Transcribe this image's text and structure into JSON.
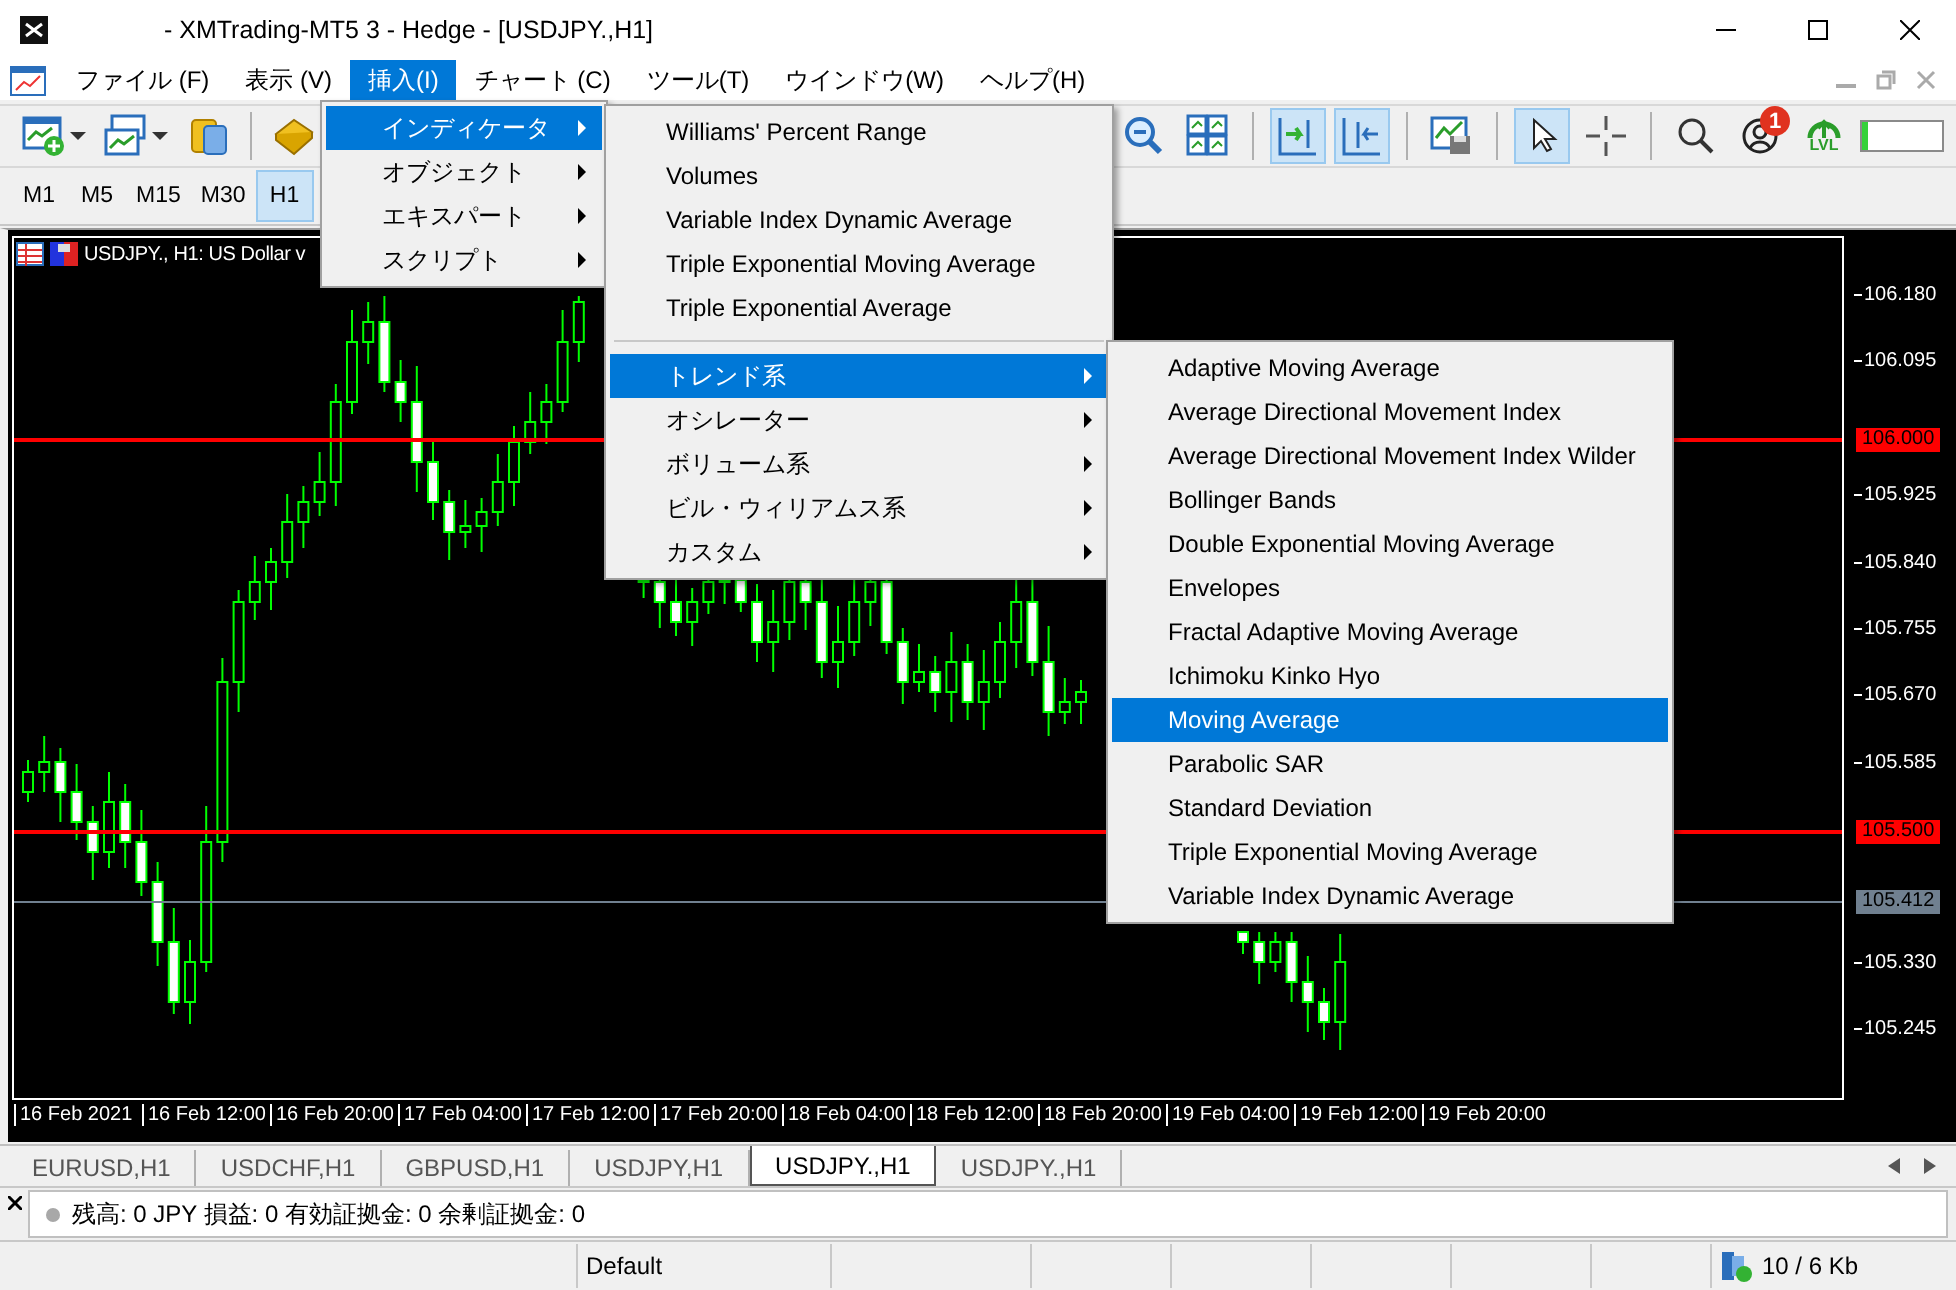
{
  "window": {
    "title": "- XMTrading-MT5 3 - Hedge - [USDJPY.,H1]"
  },
  "menu_bar": [
    {
      "label": "ファイル (F)",
      "selected": false
    },
    {
      "label": "表示 (V)",
      "selected": false
    },
    {
      "label": "挿入(I)",
      "selected": true
    },
    {
      "label": "チャート (C)",
      "selected": false
    },
    {
      "label": "ツール(T)",
      "selected": false
    },
    {
      "label": "ウインドウ(W)",
      "selected": false
    },
    {
      "label": "ヘルプ(H)",
      "selected": false
    }
  ],
  "toolbar_left": [
    {
      "kind": "new-chart",
      "dropdown": true,
      "pressed": false
    },
    {
      "kind": "profiles",
      "dropdown": true,
      "pressed": false
    },
    {
      "kind": "coins",
      "dropdown": false,
      "pressed": false
    },
    {
      "kind": "separator"
    },
    {
      "kind": "book",
      "dropdown": false,
      "pressed": false
    }
  ],
  "toolbar_right": [
    {
      "kind": "zoom-out",
      "pressed": false
    },
    {
      "kind": "tile",
      "pressed": false
    },
    {
      "kind": "separator"
    },
    {
      "kind": "chart-shift",
      "pressed": true
    },
    {
      "kind": "auto-scroll",
      "pressed": true
    },
    {
      "kind": "separator"
    },
    {
      "kind": "template",
      "pressed": false
    },
    {
      "kind": "separator"
    },
    {
      "kind": "cursor",
      "pressed": true
    },
    {
      "kind": "crosshair",
      "pressed": false
    },
    {
      "kind": "separator"
    },
    {
      "kind": "search",
      "pressed": false
    },
    {
      "kind": "account",
      "badge": "1",
      "pressed": false
    },
    {
      "kind": "signal",
      "label": "LVL",
      "pressed": false
    },
    {
      "kind": "meter",
      "level": 0.08
    }
  ],
  "timeframes": [
    {
      "label": "M1",
      "selected": false
    },
    {
      "label": "M5",
      "selected": false
    },
    {
      "label": "M15",
      "selected": false
    },
    {
      "label": "M30",
      "selected": false
    },
    {
      "label": "H1",
      "selected": true
    }
  ],
  "chart": {
    "title": "USDJPY., H1: US Dollar v",
    "price_ticks": [
      "106.180",
      "106.095",
      "105.925",
      "105.840",
      "105.755",
      "105.670",
      "105.585",
      "105.330",
      "105.245"
    ],
    "levels": [
      {
        "label": "106.000",
        "kind": "alert"
      },
      {
        "label": "105.500",
        "kind": "alert"
      },
      {
        "label": "105.412",
        "kind": "price"
      }
    ],
    "time_labels": [
      "16 Feb 2021",
      "16 Feb 12:00",
      "16 Feb 20:00",
      "17 Feb 04:00",
      "17 Feb 12:00",
      "17 Feb 20:00",
      "18 Feb 04:00",
      "18 Feb 12:00",
      "18 Feb 20:00",
      "19 Feb 04:00",
      "19 Feb 12:00",
      "19 Feb 20:00"
    ]
  },
  "menus": [
    {
      "items": [
        {
          "label": "インディケータ",
          "selected": true,
          "submenu": true,
          "divider_before": false
        },
        {
          "label": "オブジェクト",
          "selected": false,
          "submenu": true,
          "divider_before": false
        },
        {
          "label": "エキスパート",
          "selected": false,
          "submenu": true,
          "divider_before": false
        },
        {
          "label": "スクリプト",
          "selected": false,
          "submenu": true,
          "divider_before": false
        }
      ]
    },
    {
      "items": [
        {
          "label": "Williams' Percent Range",
          "selected": false,
          "submenu": false,
          "divider_before": false
        },
        {
          "label": "Volumes",
          "selected": false,
          "submenu": false,
          "divider_before": false
        },
        {
          "label": "Variable Index Dynamic Average",
          "selected": false,
          "submenu": false,
          "divider_before": false
        },
        {
          "label": "Triple Exponential Moving Average",
          "selected": false,
          "submenu": false,
          "divider_before": false
        },
        {
          "label": "Triple Exponential Average",
          "selected": false,
          "submenu": false,
          "divider_before": false
        },
        {
          "label": "トレンド系",
          "selected": true,
          "submenu": true,
          "divider_before": true
        },
        {
          "label": "オシレーター",
          "selected": false,
          "submenu": true,
          "divider_before": false
        },
        {
          "label": "ボリューム系",
          "selected": false,
          "submenu": true,
          "divider_before": false
        },
        {
          "label": "ビル・ウィリアムス系",
          "selected": false,
          "submenu": true,
          "divider_before": false
        },
        {
          "label": "カスタム",
          "selected": false,
          "submenu": true,
          "divider_before": false
        }
      ]
    },
    {
      "items": [
        {
          "label": "Adaptive Moving Average",
          "selected": false,
          "submenu": false,
          "divider_before": false
        },
        {
          "label": "Average Directional Movement Index",
          "selected": false,
          "submenu": false,
          "divider_before": false
        },
        {
          "label": "Average Directional Movement Index Wilder",
          "selected": false,
          "submenu": false,
          "divider_before": false
        },
        {
          "label": "Bollinger Bands",
          "selected": false,
          "submenu": false,
          "divider_before": false
        },
        {
          "label": "Double Exponential Moving Average",
          "selected": false,
          "submenu": false,
          "divider_before": false
        },
        {
          "label": "Envelopes",
          "selected": false,
          "submenu": false,
          "divider_before": false
        },
        {
          "label": "Fractal Adaptive Moving Average",
          "selected": false,
          "submenu": false,
          "divider_before": false
        },
        {
          "label": "Ichimoku Kinko Hyo",
          "selected": false,
          "submenu": false,
          "divider_before": false
        },
        {
          "label": "Moving Average",
          "selected": true,
          "submenu": false,
          "divider_before": false
        },
        {
          "label": "Parabolic SAR",
          "selected": false,
          "submenu": false,
          "divider_before": false
        },
        {
          "label": "Standard Deviation",
          "selected": false,
          "submenu": false,
          "divider_before": false
        },
        {
          "label": "Triple Exponential Moving Average",
          "selected": false,
          "submenu": false,
          "divider_before": false
        },
        {
          "label": "Variable Index Dynamic Average",
          "selected": false,
          "submenu": false,
          "divider_before": false
        }
      ]
    }
  ],
  "tabs": [
    {
      "label": "EURUSD,H1",
      "selected": false
    },
    {
      "label": "USDCHF,H1",
      "selected": false
    },
    {
      "label": "GBPUSD,H1",
      "selected": false
    },
    {
      "label": "USDJPY,H1",
      "selected": false
    },
    {
      "label": "USDJPY.,H1",
      "selected": true
    },
    {
      "label": "USDJPY.,H1",
      "selected": false
    }
  ],
  "account_bar": {
    "text": "残高: 0 JPY 損益: 0 有効証拠金: 0 余剰証拠金: 0"
  },
  "status_bar": {
    "profile": "Default",
    "traffic": "10 / 6 Kb"
  }
}
